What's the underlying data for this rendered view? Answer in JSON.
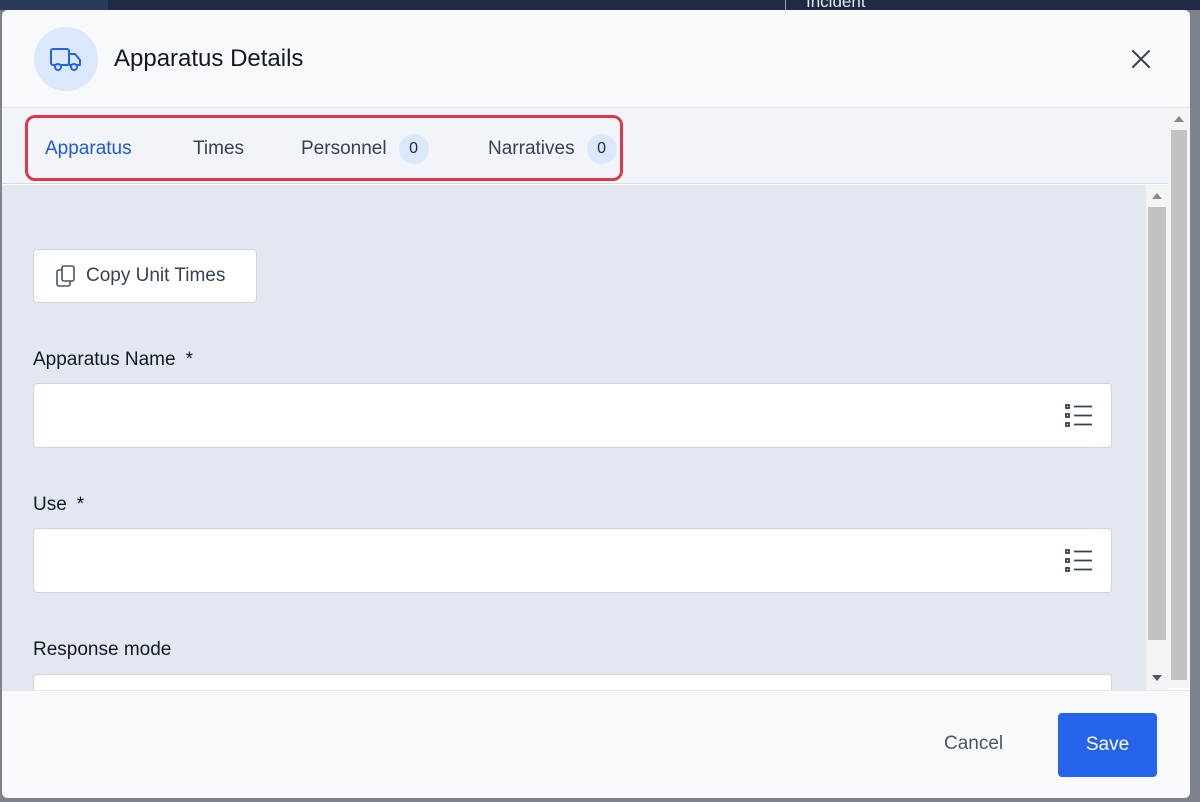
{
  "background": {
    "partial_text": "Incident"
  },
  "dialog": {
    "title": "Apparatus Details",
    "header_icon": "truck-icon",
    "close_icon": "close-icon"
  },
  "tabs": [
    {
      "label": "Apparatus",
      "active": true
    },
    {
      "label": "Times"
    },
    {
      "label": "Personnel",
      "badge": "0"
    },
    {
      "label": "Narratives",
      "badge": "0"
    }
  ],
  "copy_button": {
    "label": "Copy Unit Times",
    "icon": "copy-icon"
  },
  "fields": [
    {
      "label": "Apparatus Name",
      "required_mark": "*",
      "value": "",
      "icon": "list-icon"
    },
    {
      "label": "Use",
      "required_mark": "*",
      "value": "",
      "icon": "list-icon"
    },
    {
      "label": "Response mode",
      "required_mark": "",
      "value": "",
      "icon": "list-icon"
    }
  ],
  "footer": {
    "cancel_label": "Cancel",
    "save_label": "Save"
  },
  "colors": {
    "accent": "#2563eb",
    "active_tab": "#2458d6",
    "highlight_border": "#e0364a",
    "badge_bg": "#dbe7fb"
  }
}
